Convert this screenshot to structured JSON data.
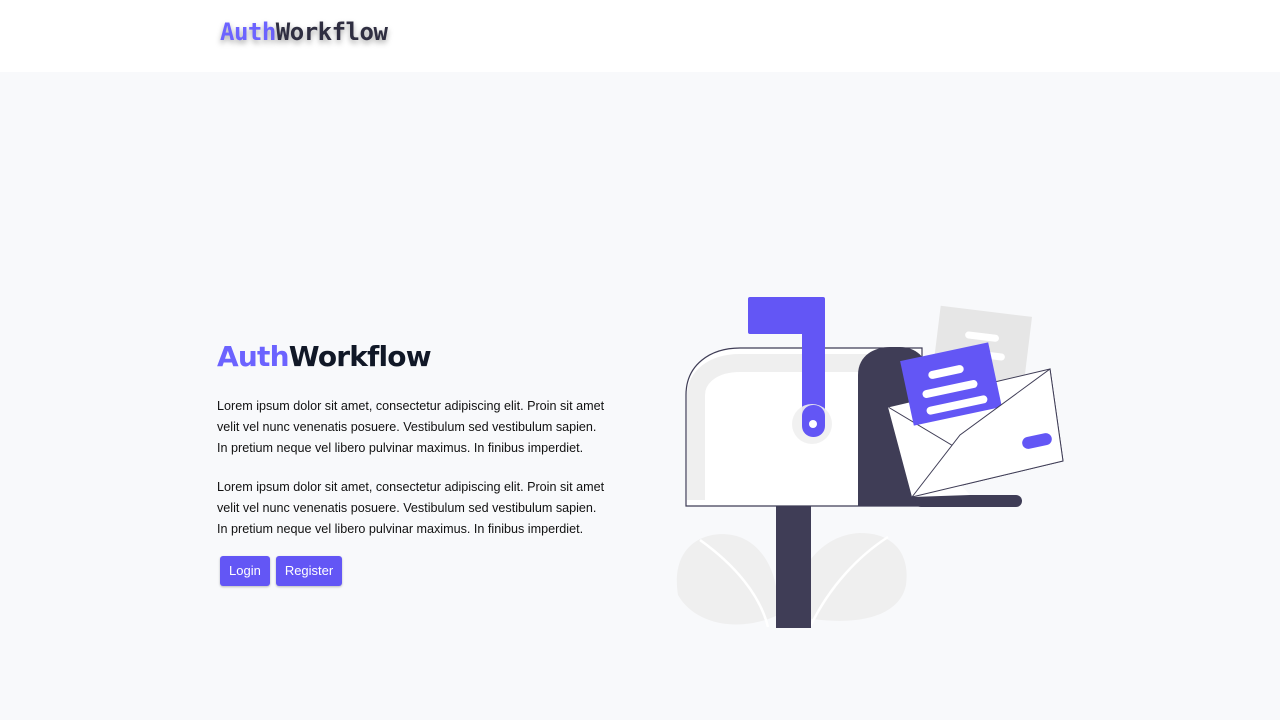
{
  "navbar": {
    "brand_part1": "Auth",
    "brand_part2": "Workflow"
  },
  "hero": {
    "title_part1": "Auth",
    "title_part2": "Workflow",
    "paragraphs": [
      "Lorem ipsum dolor sit amet, consectetur adipiscing elit. Proin sit amet velit vel nunc venenatis posuere. Vestibulum sed vestibulum sapien. In pretium neque vel libero pulvinar maximus. In finibus imperdiet.",
      "Lorem ipsum dolor sit amet, consectetur adipiscing elit. Proin sit amet velit vel nunc venenatis posuere. Vestibulum sed vestibulum sapien. In pretium neque vel libero pulvinar maximus. In finibus imperdiet."
    ],
    "login_label": "Login",
    "register_label": "Register"
  },
  "colors": {
    "accent": "#6c63ff",
    "dark": "#2f2e41",
    "background": "#f8f9fb"
  },
  "illustration": {
    "icon": "mailbox-with-envelope-illustration"
  }
}
